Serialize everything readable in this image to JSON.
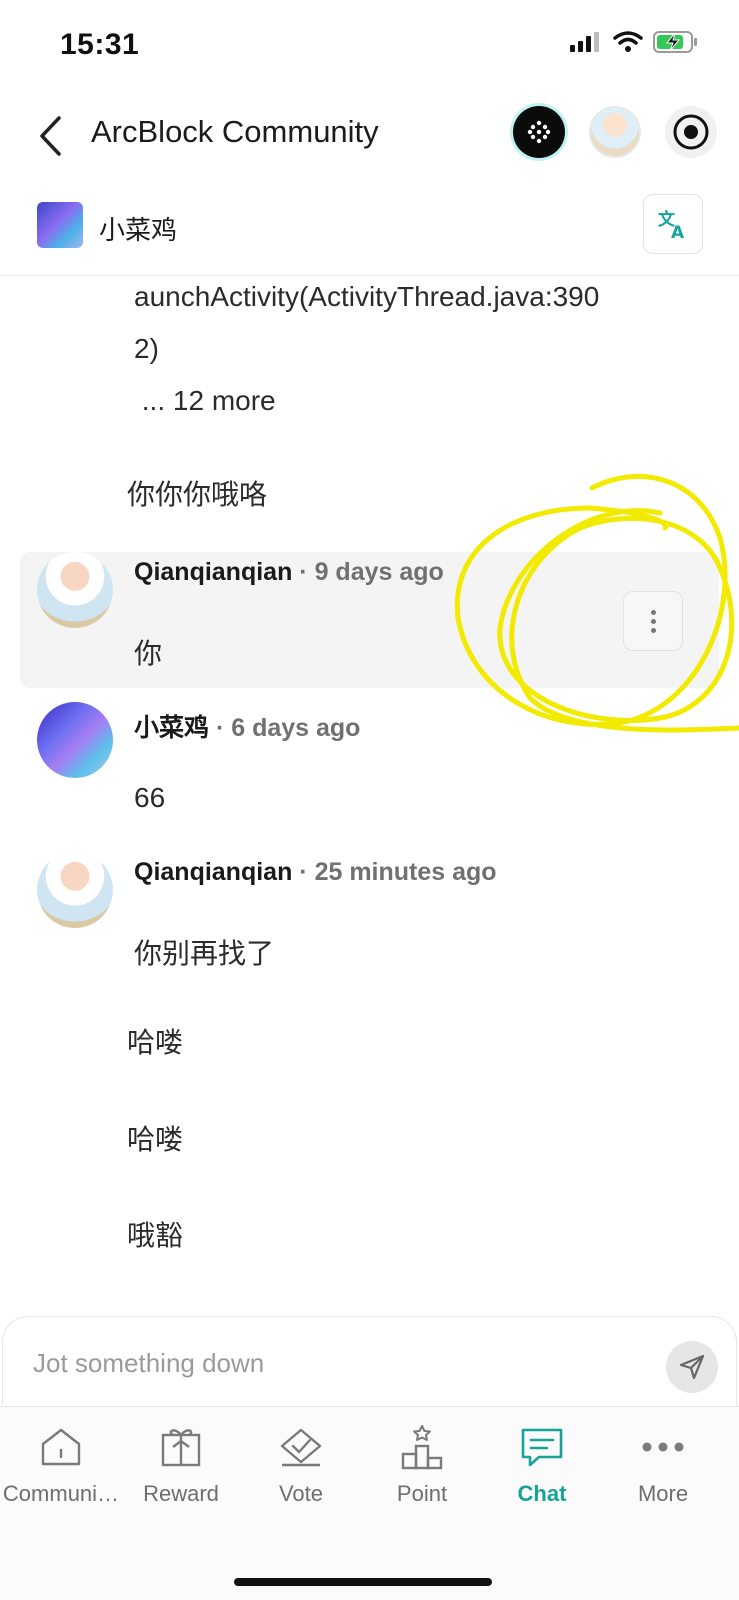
{
  "status_bar": {
    "time": "15:31"
  },
  "header": {
    "title": "ArcBlock Community"
  },
  "channel": {
    "name": "小菜鸡"
  },
  "messages": {
    "code_line_1": "aunchActivity(ActivityThread.java:390",
    "code_line_2": "2)",
    "code_line_3": " ... 12 more",
    "plain_1": "你你你哦咯",
    "m1": {
      "author": "Qianqianqian",
      "time": " · 9 days ago",
      "text": "你"
    },
    "m2": {
      "author": "小菜鸡",
      "time": " · 6 days ago",
      "text": "66"
    },
    "m3": {
      "author": "Qianqianqian",
      "time": " · 25 minutes ago",
      "text": "你别再找了"
    },
    "plain_2": "哈喽",
    "plain_3": "哈喽",
    "plain_4": "哦豁"
  },
  "composer": {
    "placeholder": "Jot something down"
  },
  "nav": {
    "items": [
      {
        "label": "Communi…",
        "icon": "community-icon"
      },
      {
        "label": "Reward",
        "icon": "gift-icon"
      },
      {
        "label": "Vote",
        "icon": "vote-icon"
      },
      {
        "label": "Point",
        "icon": "podium-icon"
      },
      {
        "label": "Chat",
        "icon": "chat-icon"
      },
      {
        "label": "More",
        "icon": "more-icon"
      }
    ],
    "active": "Chat"
  },
  "colors": {
    "accent": "#16a39a",
    "annotation": "#f2ea00"
  }
}
